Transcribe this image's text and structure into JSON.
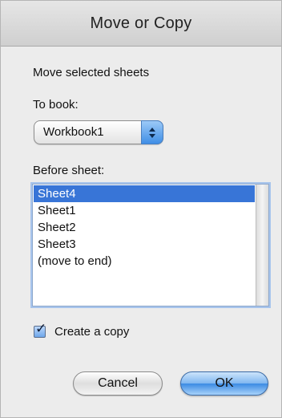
{
  "window": {
    "title": "Move or Copy"
  },
  "content": {
    "instruction": "Move selected sheets",
    "to_book_label": "To book:",
    "to_book_value": "Workbook1",
    "before_sheet_label": "Before sheet:",
    "sheets": [
      {
        "label": "Sheet4",
        "selected": true
      },
      {
        "label": "Sheet1",
        "selected": false
      },
      {
        "label": "Sheet2",
        "selected": false
      },
      {
        "label": "Sheet3",
        "selected": false
      },
      {
        "label": "(move to end)",
        "selected": false
      }
    ],
    "create_copy_label": "Create a copy",
    "create_copy_checked": true
  },
  "buttons": {
    "cancel_label": "Cancel",
    "ok_label": "OK"
  },
  "colors": {
    "selection": "#3875d7",
    "accent": "#3b8ae3"
  },
  "icons": {
    "popup_arrows": "up-down-arrows-icon",
    "checkbox_checked": "checkmark-icon"
  }
}
